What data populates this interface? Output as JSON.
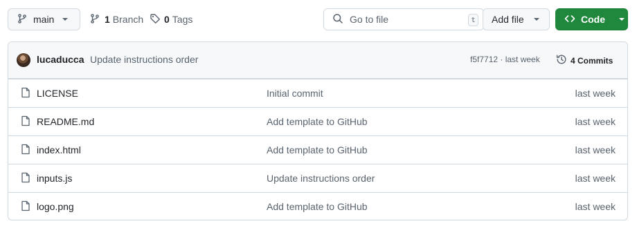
{
  "toolbar": {
    "branch_name": "main",
    "branches_count": "1",
    "branches_label": "Branch",
    "tags_count": "0",
    "tags_label": "Tags",
    "search_placeholder": "Go to file",
    "search_shortcut": "t",
    "add_file_label": "Add file",
    "code_label": "Code"
  },
  "latest_commit": {
    "author": "lucaducca",
    "message": "Update instructions order",
    "hash_time": "f5f7712 · last week",
    "commits_count_label": "4 Commits"
  },
  "files": [
    {
      "name": "LICENSE",
      "message": "Initial commit",
      "date": "last week"
    },
    {
      "name": "README.md",
      "message": "Add template to GitHub",
      "date": "last week"
    },
    {
      "name": "index.html",
      "message": "Add template to GitHub",
      "date": "last week"
    },
    {
      "name": "inputs.js",
      "message": "Update instructions order",
      "date": "last week"
    },
    {
      "name": "logo.png",
      "message": "Add template to GitHub",
      "date": "last week"
    }
  ],
  "colors": {
    "primary_green": "#1f883d",
    "border": "#d1d9e0",
    "muted_text": "#59636e",
    "header_bg": "#f6f8fa"
  },
  "icons": [
    "git-branch-icon",
    "tag-icon",
    "search-icon",
    "code-icon",
    "history-icon",
    "file-icon",
    "chevron-down-icon"
  ]
}
